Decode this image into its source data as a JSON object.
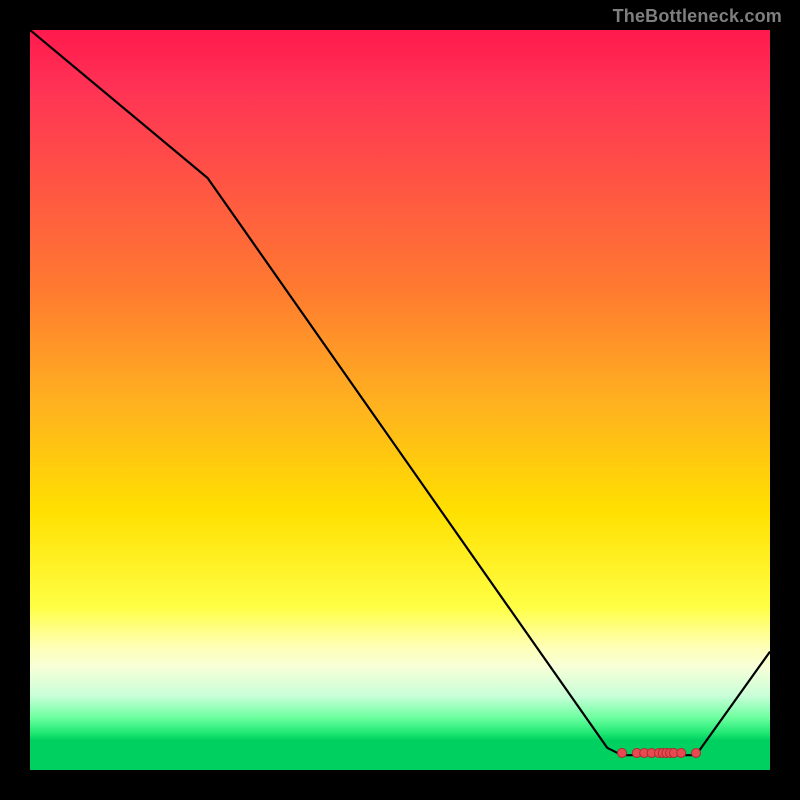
{
  "attribution": "TheBottleneck.com",
  "colors": {
    "page_bg": "#000000",
    "line": "#000000",
    "marker_fill": "#e84a52",
    "marker_stroke": "#b02a30",
    "gradient_top": "#ff1a4d",
    "gradient_bottom": "#00d060"
  },
  "chart_data": {
    "type": "line",
    "title": "",
    "xlabel": "",
    "ylabel": "",
    "xlim": [
      0,
      100
    ],
    "ylim": [
      0,
      100
    ],
    "grid": false,
    "legend": false,
    "x": [
      0,
      24,
      78,
      80,
      82,
      84,
      85.5,
      87,
      88,
      89,
      90,
      100
    ],
    "y": [
      100,
      80,
      3,
      2,
      2,
      2,
      2,
      2,
      2,
      2,
      2,
      16
    ],
    "markers_x": [
      80,
      82,
      83,
      84,
      85,
      85.5,
      86,
      86.5,
      87,
      88,
      90
    ],
    "markers_y": [
      2.3,
      2.3,
      2.3,
      2.3,
      2.3,
      2.3,
      2.3,
      2.3,
      2.3,
      2.3,
      2.3
    ]
  }
}
